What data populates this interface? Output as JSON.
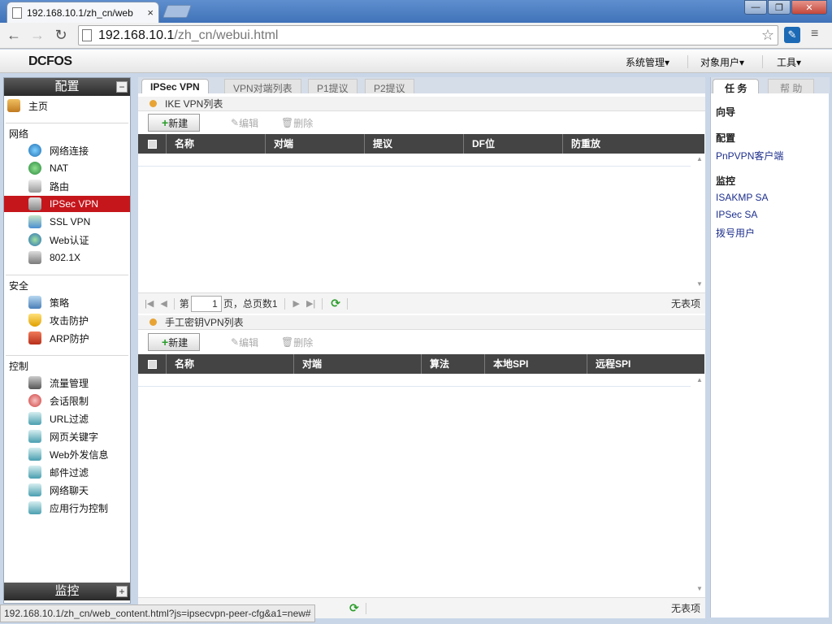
{
  "browser": {
    "tab_title": "192.168.10.1/zh_cn/web",
    "tab_close": "×",
    "url_host": "192.168.10.1",
    "url_path": "/zh_cn/webui.html",
    "ext_label": "",
    "window_buttons": [
      "—",
      "❐",
      "✕"
    ]
  },
  "app": {
    "logo": "DCFOS",
    "top_menu": [
      "系统管理▾",
      "对象用户▾",
      "工具▾"
    ]
  },
  "sidebar": {
    "config_header": "配置",
    "monitor_header": "监控",
    "home": "主页",
    "groups": {
      "network": "网络",
      "security": "安全",
      "control": "控制"
    },
    "network_items": [
      "网络连接",
      "NAT",
      "路由",
      "IPSec VPN",
      "SSL VPN",
      "Web认证",
      "802.1X"
    ],
    "security_items": [
      "策略",
      "攻击防护",
      "ARP防护"
    ],
    "control_items": [
      "流量管理",
      "会话限制",
      "URL过滤",
      "网页关键字",
      "Web外发信息",
      "邮件过滤",
      "网络聊天",
      "应用行为控制"
    ],
    "collapse": "−",
    "expand": "+"
  },
  "main": {
    "tabs": [
      "IPSec VPN",
      "VPN对端列表",
      "P1提议",
      "P2提议"
    ],
    "ike": {
      "title": "IKE VPN列表",
      "new": "新建",
      "edit": "编辑",
      "delete": "删除",
      "columns": [
        "名称",
        "对端",
        "提议",
        "DF位",
        "防重放"
      ]
    },
    "manual": {
      "title": "手工密钥VPN列表",
      "new": "新建",
      "edit": "编辑",
      "delete": "删除",
      "columns": [
        "名称",
        "对端",
        "算法",
        "本地SPI",
        "远程SPI"
      ]
    },
    "pager": {
      "page_prefix": "第",
      "page_value": "1",
      "page_suffix": "页，总页数1",
      "no_records": "无表项"
    }
  },
  "right_panel": {
    "tabs": [
      "任 务",
      "帮 助"
    ],
    "wizard": "向导",
    "config": "配置",
    "config_links": [
      "PnPVPN客户端"
    ],
    "monitor": "监控",
    "monitor_links": [
      "ISAKMP SA",
      "IPSec SA",
      "拨号用户"
    ]
  },
  "status_bar": {
    "text": "192.168.10.1/zh_cn/web_content.html?js=ipsecvpn-peer-cfg&a1=new#"
  },
  "colors": {
    "active_item": "#c5161c",
    "table_header": "#444444",
    "link": "#1d2f8c",
    "accent_dot": "#e7a434"
  }
}
